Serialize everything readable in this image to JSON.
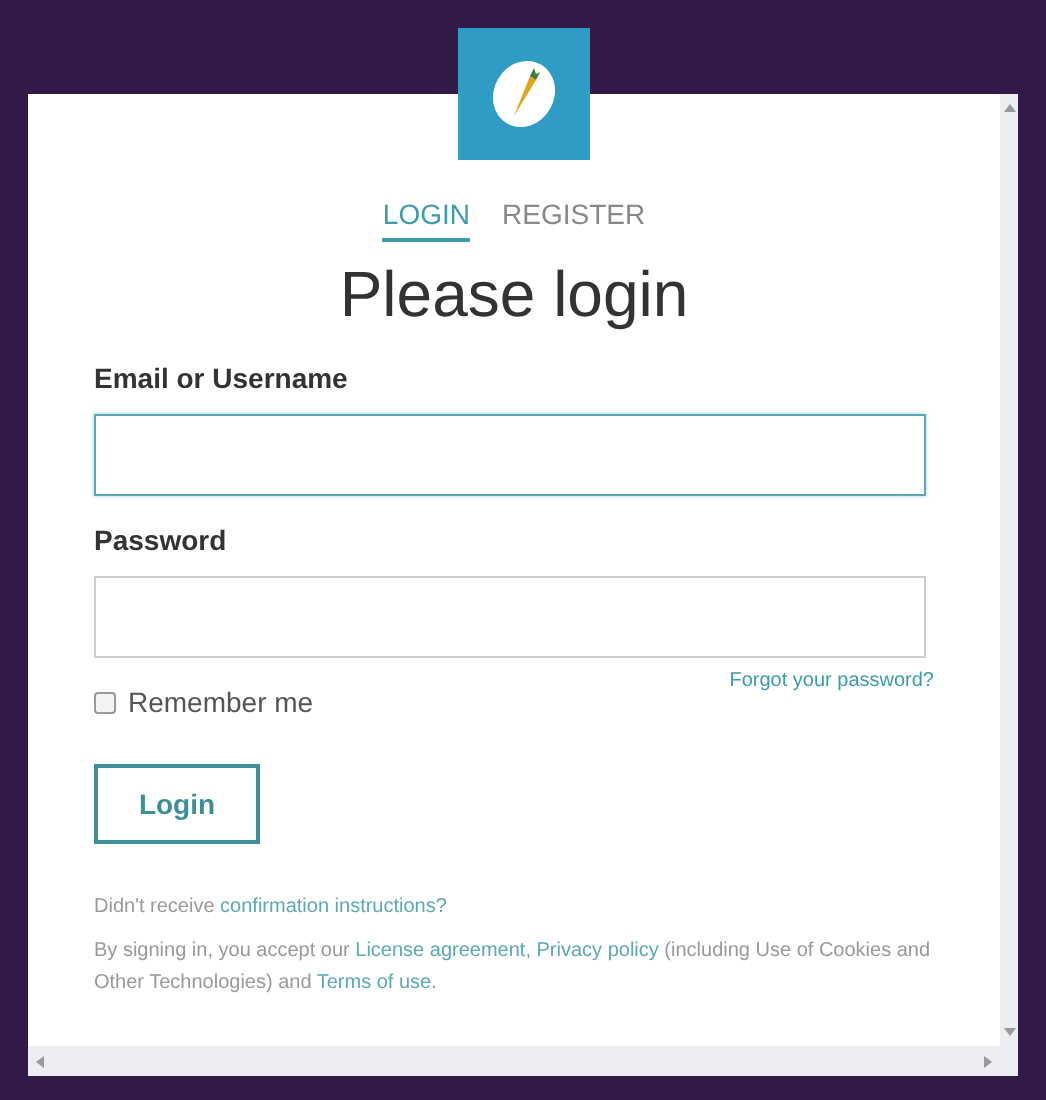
{
  "tabs": [
    {
      "label": "LOGIN",
      "selected": true
    },
    {
      "label": "REGISTER",
      "selected": false
    }
  ],
  "heading": "Please login",
  "fields": [
    {
      "label": "Email or Username",
      "focused": true
    },
    {
      "label": "Password",
      "focused": false
    }
  ],
  "forgot_link": "Forgot your password?",
  "remember": {
    "label": "Remember me",
    "checked": false
  },
  "login_button": "Login",
  "notes": [
    [
      {
        "kind": "text",
        "text": "Didn't receive "
      },
      {
        "kind": "link",
        "text": "confirmation instructions?"
      }
    ],
    [
      {
        "kind": "text",
        "text": "By signing in, you accept our "
      },
      {
        "kind": "link",
        "text": "License agreement"
      },
      {
        "kind": "text",
        "text": ", "
      },
      {
        "kind": "link",
        "text": "Privacy policy"
      },
      {
        "kind": "text",
        "text": " (including Use of Cookies and Other Technologies) and "
      },
      {
        "kind": "link",
        "text": "Terms of use"
      },
      {
        "kind": "text",
        "text": "."
      }
    ]
  ]
}
